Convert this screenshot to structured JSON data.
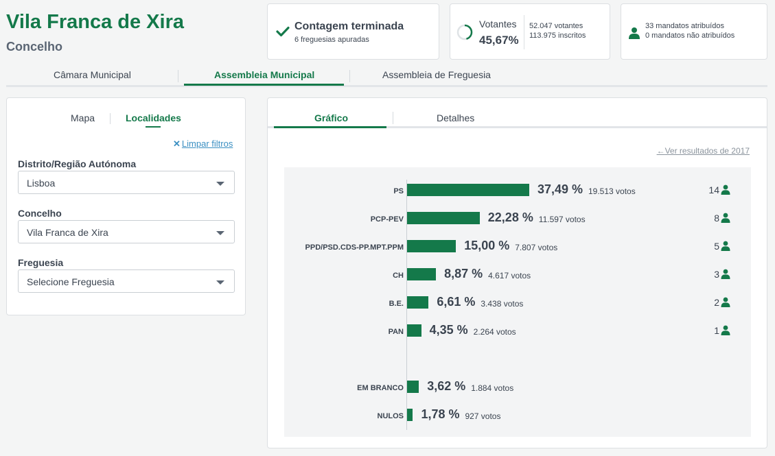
{
  "header": {
    "title": "Vila Franca de Xira",
    "subtitle": "Concelho"
  },
  "status_card": {
    "title": "Contagem terminada",
    "detail": "6 freguesias apuradas"
  },
  "voters_card": {
    "label": "Votantes",
    "percent": "45,67%",
    "voters": "52.047 votantes",
    "registered": "113.975 inscritos",
    "turnout_fraction": 0.4567
  },
  "seats_card": {
    "assigned": "33 mandatos atribuídos",
    "unassigned": "0 mandatos não atribuídos"
  },
  "main_tabs": [
    {
      "label": "Câmara Municipal"
    },
    {
      "label": "Assembleia Municipal"
    },
    {
      "label": "Assembleia de Freguesia"
    }
  ],
  "filters": {
    "tabs": [
      {
        "label": "Mapa"
      },
      {
        "label": "Localidades"
      }
    ],
    "clear_label": "Limpar filtros",
    "district_label": "Distrito/Região Autónoma",
    "district_value": "Lisboa",
    "county_label": "Concelho",
    "county_value": "Vila Franca de Xira",
    "parish_label": "Freguesia",
    "parish_value": "Selecione Freguesia"
  },
  "results": {
    "tabs": [
      {
        "label": "Gráfico"
      },
      {
        "label": "Detalhes"
      }
    ],
    "prev_link": "Ver resultados de 2017"
  },
  "colors": {
    "accent": "#14794a",
    "text": "#3b4450",
    "link": "#3a8fc2"
  },
  "chart_data": {
    "type": "bar",
    "orientation": "horizontal",
    "categories": [
      "PS",
      "PCP-PEV",
      "PPD/PSD.CDS-PP.MPT.PPM",
      "CH",
      "B.E.",
      "PAN",
      "EM BRANCO",
      "NULOS"
    ],
    "values": [
      37.49,
      22.28,
      15.0,
      8.87,
      6.61,
      4.35,
      3.62,
      1.78
    ],
    "rows": [
      {
        "party": "PS",
        "value": 37.49,
        "pct": "37,49 %",
        "votes": "19.513 votos",
        "seats": "14"
      },
      {
        "party": "PCP-PEV",
        "value": 22.28,
        "pct": "22,28 %",
        "votes": "11.597 votos",
        "seats": "8"
      },
      {
        "party": "PPD/PSD.CDS-PP.MPT.PPM",
        "value": 15.0,
        "pct": "15,00 %",
        "votes": "7.807 votos",
        "seats": "5"
      },
      {
        "party": "CH",
        "value": 8.87,
        "pct": "8,87 %",
        "votes": "4.617 votos",
        "seats": "3"
      },
      {
        "party": "B.E.",
        "value": 6.61,
        "pct": "6,61 %",
        "votes": "3.438 votos",
        "seats": "2"
      },
      {
        "party": "PAN",
        "value": 4.35,
        "pct": "4,35 %",
        "votes": "2.264 votos",
        "seats": "1"
      },
      {
        "party": "EM BRANCO",
        "value": 3.62,
        "pct": "3,62 %",
        "votes": "1.884 votos",
        "seats": ""
      },
      {
        "party": "NULOS",
        "value": 1.78,
        "pct": "1,78 %",
        "votes": "927 votos",
        "seats": ""
      }
    ],
    "xlim": [
      0,
      100
    ]
  }
}
